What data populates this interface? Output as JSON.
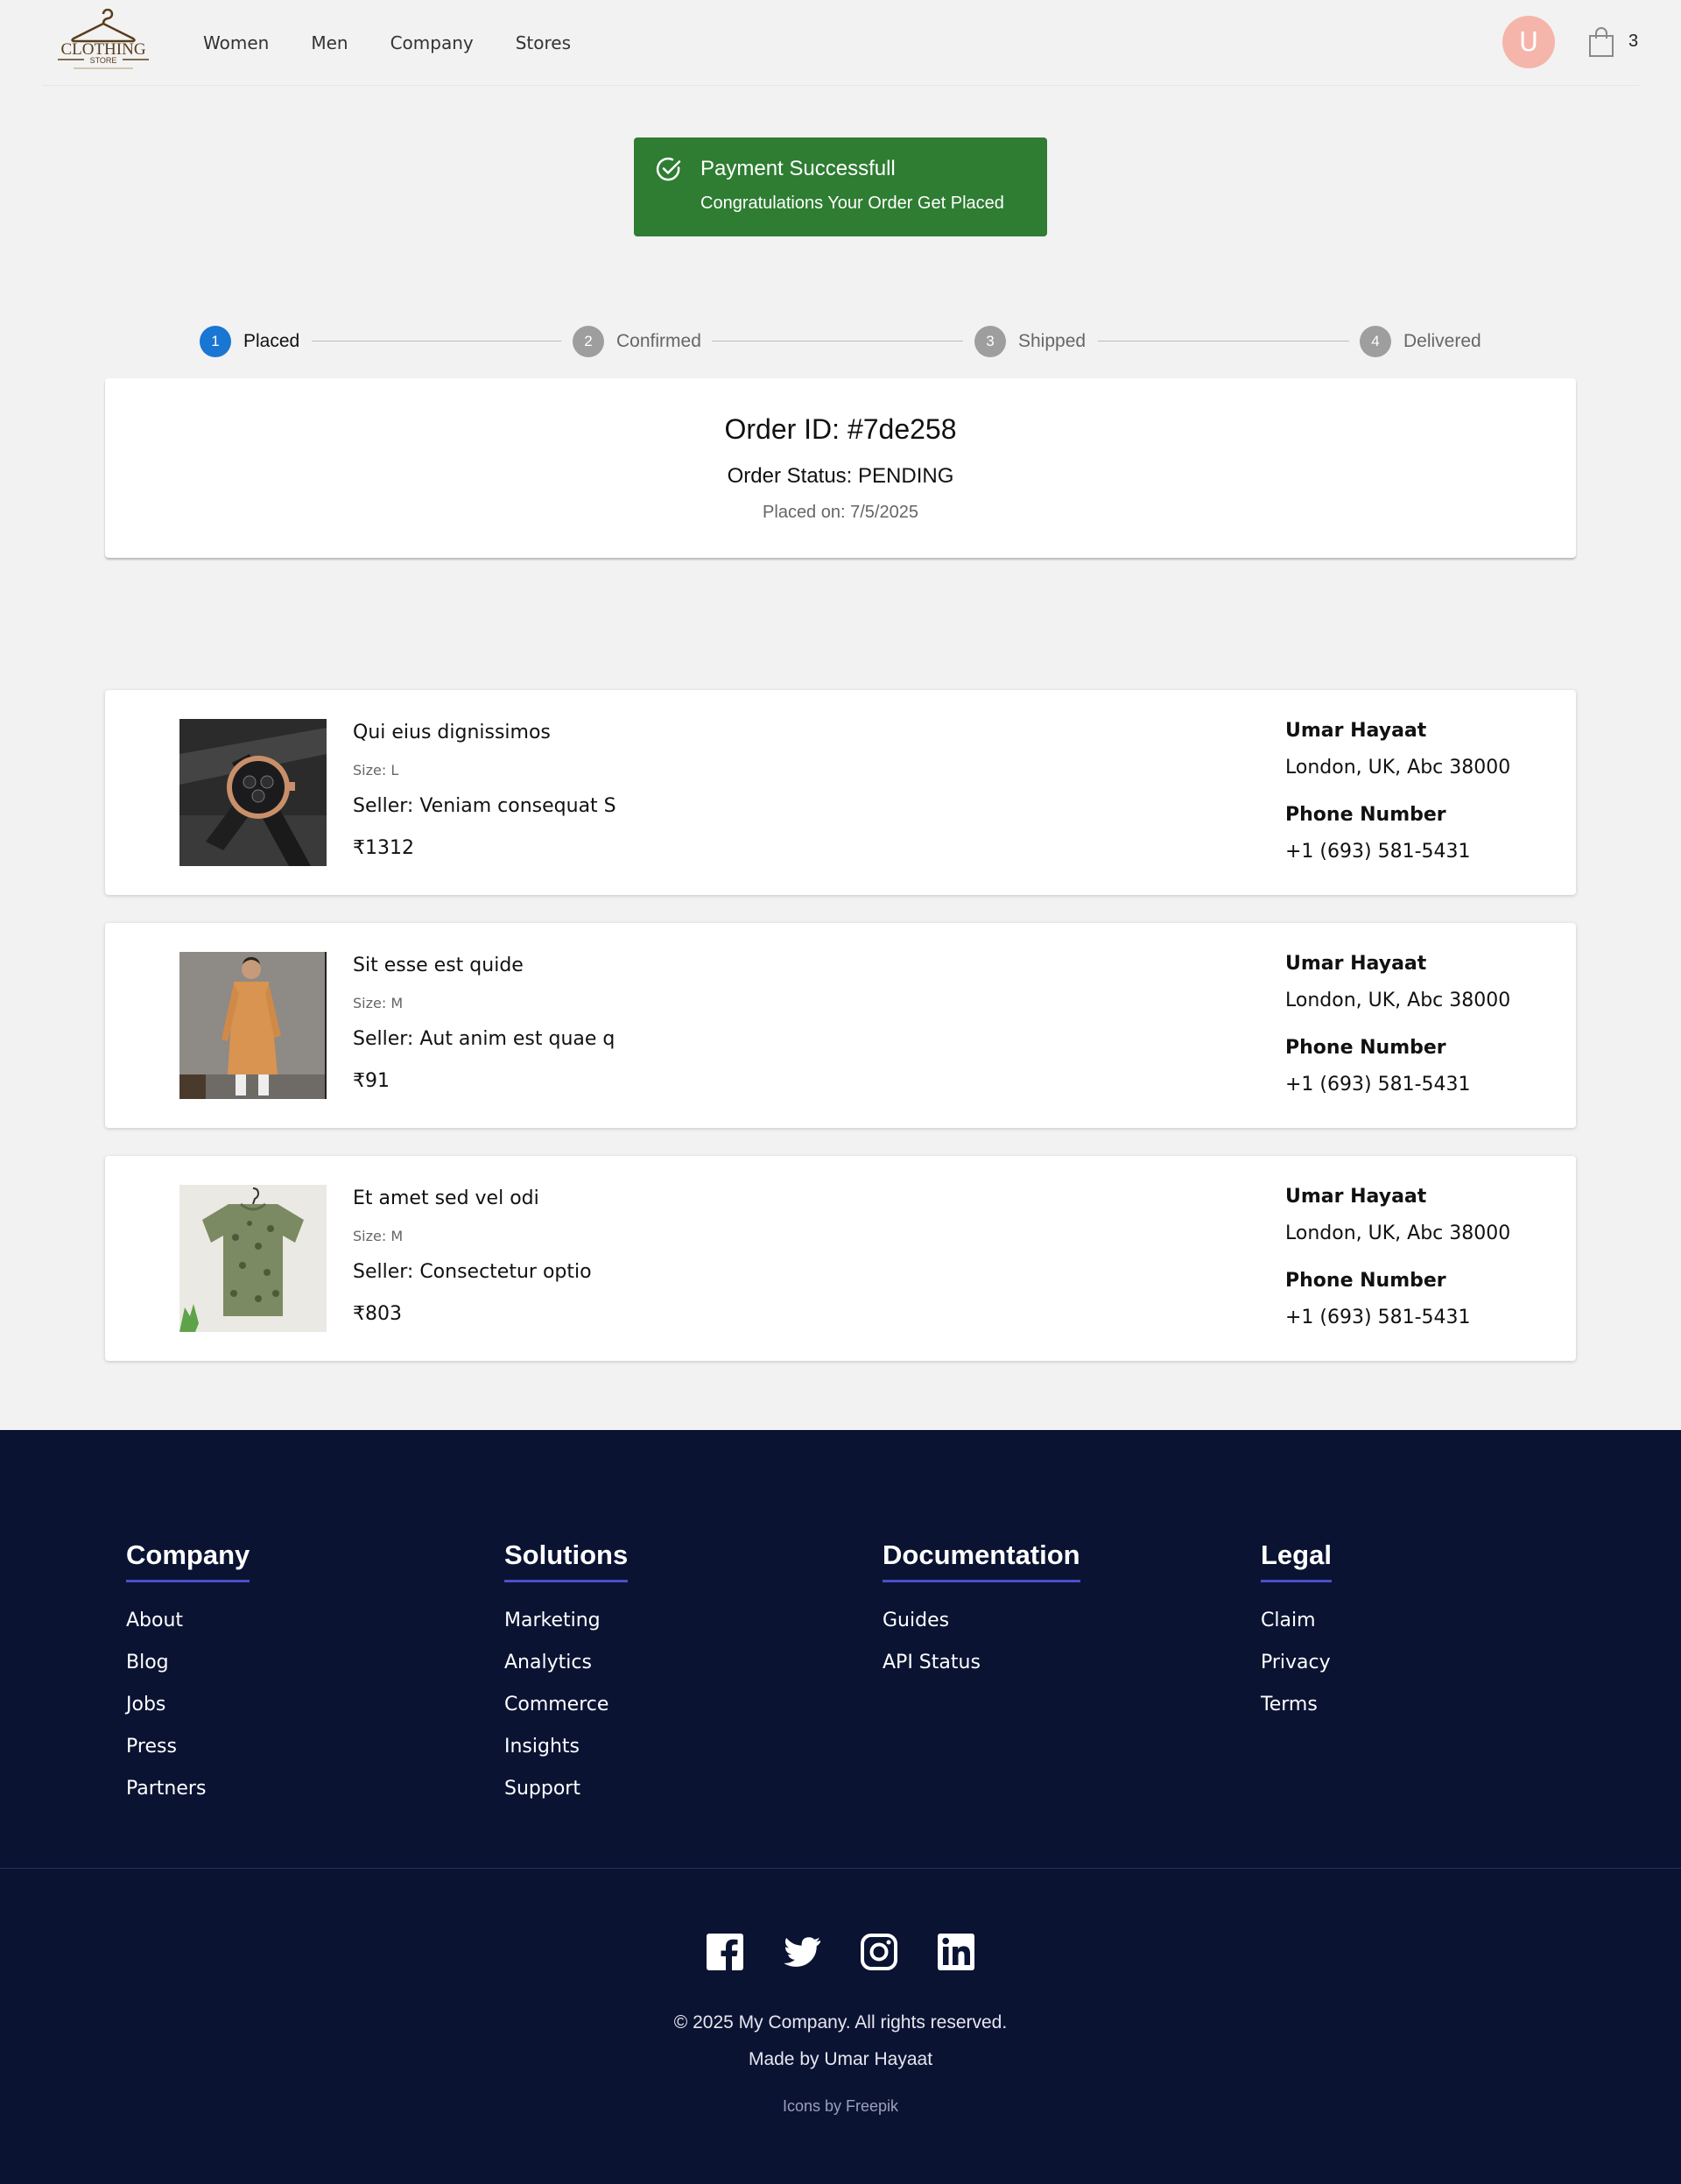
{
  "header": {
    "logo_text": "CLOTHING",
    "logo_sub": "STORE",
    "nav": [
      "Women",
      "Men",
      "Company",
      "Stores"
    ],
    "avatar_initial": "U",
    "cart_count": "3"
  },
  "alert": {
    "title": "Payment Successfull",
    "message": "Congratulations Your Order Get Placed",
    "color": "#2e7d32"
  },
  "stepper": {
    "active_step": 1,
    "steps": [
      {
        "num": "1",
        "label": "Placed"
      },
      {
        "num": "2",
        "label": "Confirmed"
      },
      {
        "num": "3",
        "label": "Shipped"
      },
      {
        "num": "4",
        "label": "Delivered"
      }
    ]
  },
  "order": {
    "id": "Order ID: #7de258",
    "status": "Order Status: PENDING",
    "placed": "Placed on: 7/5/2025"
  },
  "items": [
    {
      "name": "Qui eius dignissimos",
      "size": "Size: L",
      "seller": "Seller: Veniam consequat S",
      "price": "₹1312",
      "image": "watch",
      "ship_name": "Umar Hayaat",
      "address": "London, UK, Abc 38000",
      "phone_label": "Phone Number",
      "phone": "+1 (693) 581-5431"
    },
    {
      "name": "Sit esse est quide",
      "size": "Size: M",
      "seller": "Seller: Aut anim est quae q",
      "price": "₹91",
      "image": "kurta-model",
      "ship_name": "Umar Hayaat",
      "address": "London, UK, Abc 38000",
      "phone_label": "Phone Number",
      "phone": "+1 (693) 581-5431"
    },
    {
      "name": "Et amet sed vel odi",
      "size": "Size: M",
      "seller": "Seller: Consectetur optio",
      "price": "₹803",
      "image": "printed-tshirt",
      "ship_name": "Umar Hayaat",
      "address": "London, UK, Abc 38000",
      "phone_label": "Phone Number",
      "phone": "+1 (693) 581-5431"
    }
  ],
  "footer": {
    "columns": [
      {
        "heading": "Company",
        "links": [
          "About",
          "Blog",
          "Jobs",
          "Press",
          "Partners"
        ]
      },
      {
        "heading": "Solutions",
        "links": [
          "Marketing",
          "Analytics",
          "Commerce",
          "Insights",
          "Support"
        ]
      },
      {
        "heading": "Documentation",
        "links": [
          "Guides",
          "API Status"
        ]
      },
      {
        "heading": "Legal",
        "links": [
          "Claim",
          "Privacy",
          "Terms"
        ]
      }
    ],
    "socials": [
      "facebook-icon",
      "twitter-icon",
      "instagram-icon",
      "linkedin-icon"
    ],
    "copyright": "© 2025 My Company. All rights reserved.",
    "made_by": "Made by Umar Hayaat",
    "icons_by": "Icons by Freepik"
  }
}
